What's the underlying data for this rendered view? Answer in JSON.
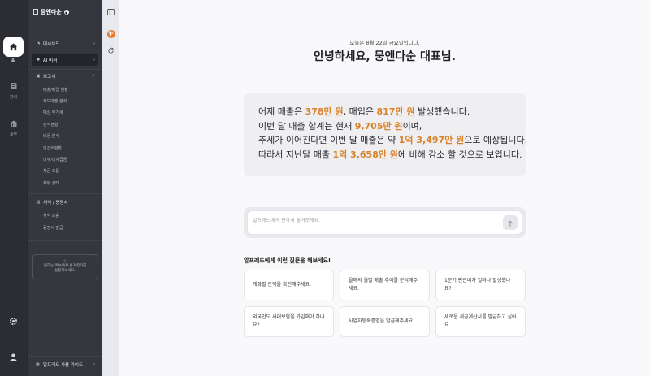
{
  "rail": {
    "items": [
      {
        "label": "",
        "icon": "home-icon"
      },
      {
        "label": "관리",
        "icon": "document-icon"
      },
      {
        "label": "세무",
        "icon": "building-icon"
      }
    ]
  },
  "sidebar": {
    "brand": "뭉앤다순",
    "top_items": [
      {
        "label": "대시보드",
        "icon": "dashboard-icon"
      },
      {
        "label": "AI 비서",
        "icon": "ai-icon"
      }
    ],
    "report_section": {
      "label": "보고서",
      "items": [
        "매출/매입 현황",
        "카드매출 분석",
        "예상 부가세",
        "손익현황",
        "비용 분석",
        "인건비현황",
        "미수/미지급금",
        "자금 흐름",
        "재무 상태"
      ]
    },
    "forms_section": {
      "label": "서식 / 증명서",
      "items": [
        "서식 모음",
        "증명서 발급"
      ]
    },
    "hint": {
      "line1": "원하는 메뉴에서 즐겨찾기를",
      "line2": "설정해보세요."
    },
    "guide_label": "알프레드 사용 가이드"
  },
  "main": {
    "date_line": "오늘은 8월 22일 금요일입니다.",
    "greeting": "안녕하세요, 뭉앤다순 대표님.",
    "summary": {
      "l1_a": "어제 매출은 ",
      "l1_b": "378만 원",
      "l1_c": ", 매입은 ",
      "l1_d": "817만 원",
      "l1_e": " 발생했습니다.",
      "l2_a": "이번 달 매출 합계는 현재 ",
      "l2_b": "9,705만 원",
      "l2_c": "이며,",
      "l3_a": "추세가 이어진다면 이번 달 매출은 약 ",
      "l3_b": "1억 3,497만 원",
      "l3_c": "으로 예상됩니다.",
      "l4_a": "따라서 지난달 매출 ",
      "l4_b": "1억 3,658만 원",
      "l4_c": "에 비해 감소 할 것으로 보입니다."
    },
    "input_placeholder": "알프레드에게 편하게 물어보세요.",
    "suggest_title": "알프레드에게 이런 질문을 해보세요!",
    "suggestions": [
      "계좌별 잔액을 확인해주세요.",
      "올해의 월별 매출 추이를 분석해주세요.",
      "1분기 판관비가 얼마나 발생했나요?",
      "외국인도 사대보험을 가입해야 하나요?",
      "사업자등록증명을 발급해주세요.",
      "세로운 세금계산서를 발급하고 싶어요."
    ]
  },
  "colors": {
    "accent": "#d9822b",
    "sidebar_bg": "#34373d",
    "rail_bg": "#2b2d33"
  }
}
